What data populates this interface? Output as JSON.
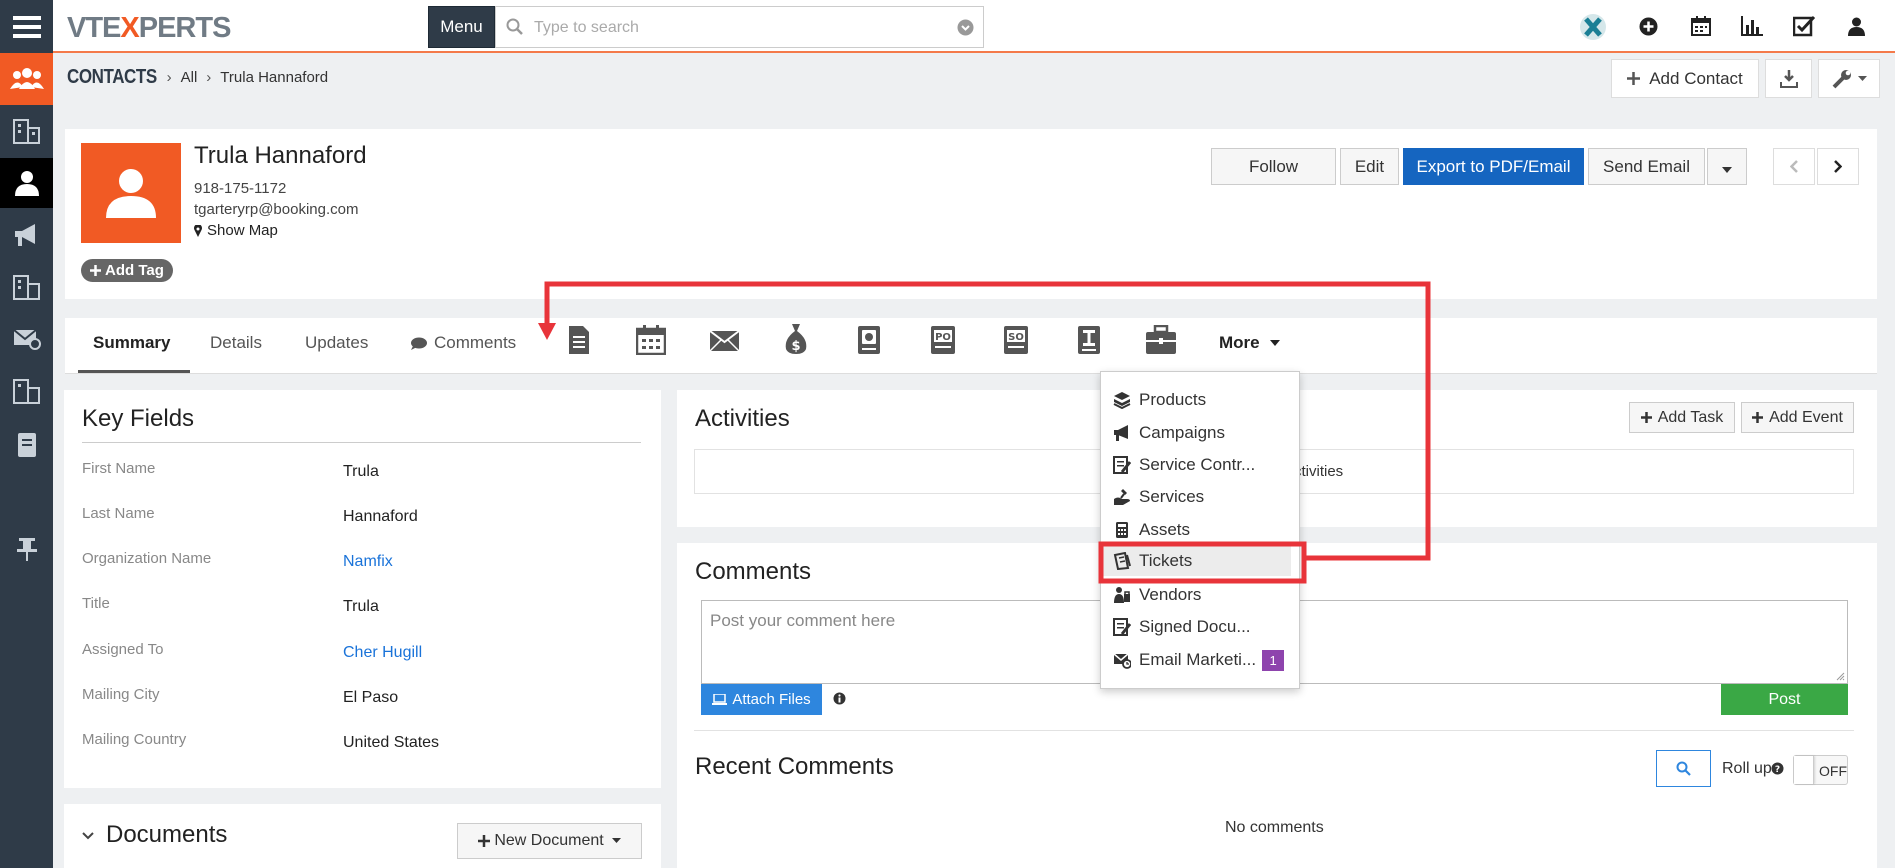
{
  "app": {
    "logo_left": "VTE",
    "logo_x": "X",
    "logo_right": "PERTS",
    "menu_label": "Menu",
    "search_placeholder": "Type to search"
  },
  "breadcrumb": {
    "module": "CONTACTS",
    "list": "All",
    "record": "Trula Hannaford"
  },
  "page_actions": {
    "add_contact": "Add Contact"
  },
  "record": {
    "name": "Trula Hannaford",
    "phone": "918-175-1172",
    "email": "tgarteryrp@booking.com",
    "show_map": "Show Map",
    "add_tag": "Add Tag"
  },
  "record_actions": {
    "follow": "Follow",
    "edit": "Edit",
    "export": "Export to PDF/Email",
    "send_email": "Send Email"
  },
  "tabs": {
    "summary": "Summary",
    "details": "Details",
    "updates": "Updates",
    "comments": "Comments",
    "more": "More"
  },
  "more_menu": {
    "items": [
      {
        "label": "Products",
        "icon": "products-icon"
      },
      {
        "label": "Campaigns",
        "icon": "campaigns-icon"
      },
      {
        "label": "Service Contr...",
        "icon": "service-contracts-icon"
      },
      {
        "label": "Services",
        "icon": "services-icon"
      },
      {
        "label": "Assets",
        "icon": "assets-icon"
      },
      {
        "label": "Tickets",
        "icon": "tickets-icon"
      },
      {
        "label": "Vendors",
        "icon": "vendors-icon"
      },
      {
        "label": "Signed Docu...",
        "icon": "signed-documents-icon"
      },
      {
        "label": "Email Marketi...",
        "icon": "email-marketing-icon"
      }
    ],
    "email_badge": "1"
  },
  "key_fields": {
    "title": "Key Fields",
    "rows": [
      {
        "label": "First Name",
        "value": "Trula"
      },
      {
        "label": "Last Name",
        "value": "Hannaford"
      },
      {
        "label": "Organization Name",
        "value": "Namfix"
      },
      {
        "label": "Title",
        "value": "Trula"
      },
      {
        "label": "Assigned To",
        "value": "Cher Hugill"
      },
      {
        "label": "Mailing City",
        "value": "El Paso"
      },
      {
        "label": "Mailing Country",
        "value": "United States"
      }
    ]
  },
  "documents": {
    "title": "Documents",
    "new_document": "New Document"
  },
  "activities": {
    "title": "Activities",
    "add_task": "Add Task",
    "add_event": "Add Event",
    "empty_text": "ctivities"
  },
  "comments": {
    "title": "Comments",
    "placeholder": "Post your comment here",
    "attach_files": "Attach Files",
    "post": "Post"
  },
  "recent_comments": {
    "title": "Recent Comments",
    "roll_up": "Roll up",
    "toggle_state": "OFF",
    "empty": "No comments"
  },
  "colors": {
    "accent": "#f15a24",
    "sidebar": "#2f3b48",
    "primary": "#1565c0",
    "post": "#3aa845",
    "highlight": "#e8343a",
    "badge": "#8e44ad"
  }
}
